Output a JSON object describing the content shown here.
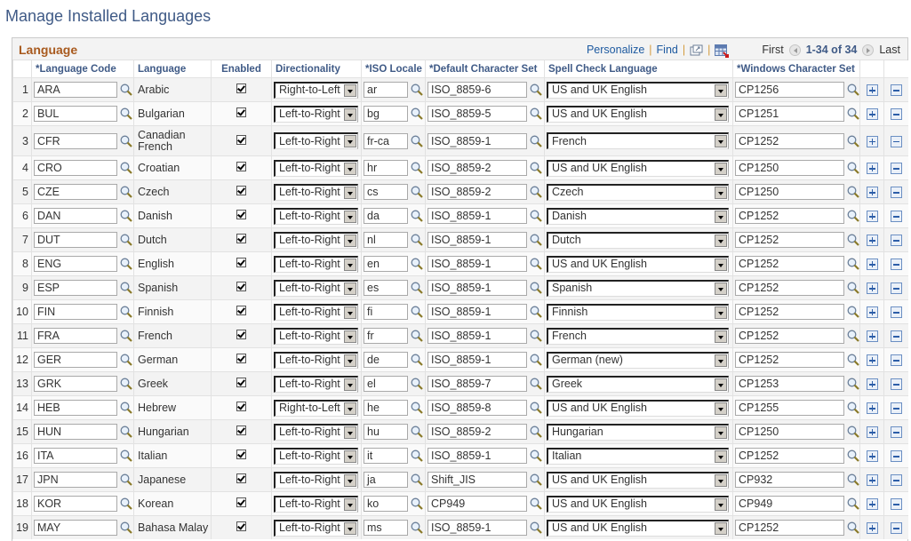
{
  "page_title": "Manage Installed Languages",
  "grid": {
    "title": "Language",
    "personalize_label": "Personalize",
    "find_label": "Find",
    "first_label": "First",
    "last_label": "Last",
    "range_label": "1-34 of 34",
    "columns": {
      "language_code": "*Language Code",
      "language": "Language",
      "enabled": "Enabled",
      "directionality": "Directionality",
      "iso_locale": "*ISO Locale",
      "default_charset": "*Default Character Set",
      "spell_check": "Spell Check Language",
      "windows_charset": "*Windows Character Set"
    },
    "rows": [
      {
        "num": "1",
        "code": "ARA",
        "language": "Arabic",
        "enabled": true,
        "directionality": "Right-to-Left",
        "iso": "ar",
        "charset": "ISO_8859-6",
        "spell": "US and UK English",
        "win": "CP1256"
      },
      {
        "num": "2",
        "code": "BUL",
        "language": "Bulgarian",
        "enabled": true,
        "directionality": "Left-to-Right",
        "iso": "bg",
        "charset": "ISO_8859-5",
        "spell": "US and UK English",
        "win": "CP1251"
      },
      {
        "num": "3",
        "code": "CFR",
        "language": "Canadian French",
        "enabled": true,
        "directionality": "Left-to-Right",
        "iso": "fr-ca",
        "charset": "ISO_8859-1",
        "spell": "French",
        "win": "CP1252"
      },
      {
        "num": "4",
        "code": "CRO",
        "language": "Croatian",
        "enabled": true,
        "directionality": "Left-to-Right",
        "iso": "hr",
        "charset": "ISO_8859-2",
        "spell": "US and UK English",
        "win": "CP1250"
      },
      {
        "num": "5",
        "code": "CZE",
        "language": "Czech",
        "enabled": true,
        "directionality": "Left-to-Right",
        "iso": "cs",
        "charset": "ISO_8859-2",
        "spell": "Czech",
        "win": "CP1250"
      },
      {
        "num": "6",
        "code": "DAN",
        "language": "Danish",
        "enabled": true,
        "directionality": "Left-to-Right",
        "iso": "da",
        "charset": "ISO_8859-1",
        "spell": "Danish",
        "win": "CP1252"
      },
      {
        "num": "7",
        "code": "DUT",
        "language": "Dutch",
        "enabled": true,
        "directionality": "Left-to-Right",
        "iso": "nl",
        "charset": "ISO_8859-1",
        "spell": "Dutch",
        "win": "CP1252"
      },
      {
        "num": "8",
        "code": "ENG",
        "language": "English",
        "enabled": true,
        "directionality": "Left-to-Right",
        "iso": "en",
        "charset": "ISO_8859-1",
        "spell": "US and UK English",
        "win": "CP1252"
      },
      {
        "num": "9",
        "code": "ESP",
        "language": "Spanish",
        "enabled": true,
        "directionality": "Left-to-Right",
        "iso": "es",
        "charset": "ISO_8859-1",
        "spell": "Spanish",
        "win": "CP1252"
      },
      {
        "num": "10",
        "code": "FIN",
        "language": "Finnish",
        "enabled": true,
        "directionality": "Left-to-Right",
        "iso": "fi",
        "charset": "ISO_8859-1",
        "spell": "Finnish",
        "win": "CP1252"
      },
      {
        "num": "11",
        "code": "FRA",
        "language": "French",
        "enabled": true,
        "directionality": "Left-to-Right",
        "iso": "fr",
        "charset": "ISO_8859-1",
        "spell": "French",
        "win": "CP1252"
      },
      {
        "num": "12",
        "code": "GER",
        "language": "German",
        "enabled": true,
        "directionality": "Left-to-Right",
        "iso": "de",
        "charset": "ISO_8859-1",
        "spell": "German (new)",
        "win": "CP1252"
      },
      {
        "num": "13",
        "code": "GRK",
        "language": "Greek",
        "enabled": true,
        "directionality": "Left-to-Right",
        "iso": "el",
        "charset": "ISO_8859-7",
        "spell": "Greek",
        "win": "CP1253"
      },
      {
        "num": "14",
        "code": "HEB",
        "language": "Hebrew",
        "enabled": true,
        "directionality": "Right-to-Left",
        "iso": "he",
        "charset": "ISO_8859-8",
        "spell": "US and UK English",
        "win": "CP1255"
      },
      {
        "num": "15",
        "code": "HUN",
        "language": "Hungarian",
        "enabled": true,
        "directionality": "Left-to-Right",
        "iso": "hu",
        "charset": "ISO_8859-2",
        "spell": "Hungarian",
        "win": "CP1250"
      },
      {
        "num": "16",
        "code": "ITA",
        "language": "Italian",
        "enabled": true,
        "directionality": "Left-to-Right",
        "iso": "it",
        "charset": "ISO_8859-1",
        "spell": "Italian",
        "win": "CP1252"
      },
      {
        "num": "17",
        "code": "JPN",
        "language": "Japanese",
        "enabled": true,
        "directionality": "Left-to-Right",
        "iso": "ja",
        "charset": "Shift_JIS",
        "spell": "US and UK English",
        "win": "CP932"
      },
      {
        "num": "18",
        "code": "KOR",
        "language": "Korean",
        "enabled": true,
        "directionality": "Left-to-Right",
        "iso": "ko",
        "charset": "CP949",
        "spell": "US and UK English",
        "win": "CP949"
      },
      {
        "num": "19",
        "code": "MAY",
        "language": "Bahasa Malay",
        "enabled": true,
        "directionality": "Left-to-Right",
        "iso": "ms",
        "charset": "ISO_8859-1",
        "spell": "US and UK English",
        "win": "CP1252"
      }
    ]
  },
  "icons": {
    "lookup": "magnifier-icon",
    "zoom_grid": "new-window-icon",
    "download": "spreadsheet-download-icon",
    "add": "plus-icon",
    "remove": "minus-icon"
  }
}
